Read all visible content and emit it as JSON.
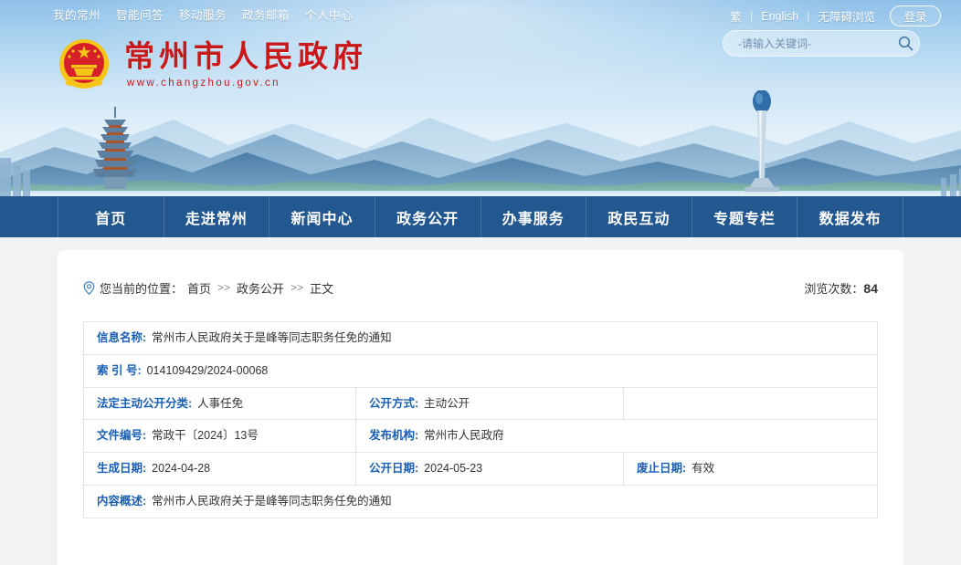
{
  "topbar": {
    "links": [
      {
        "label": "我的常州",
        "name": "topnav-my-changzhou"
      },
      {
        "label": "智能问答",
        "name": "topnav-smart-qa"
      },
      {
        "label": "移动服务",
        "name": "topnav-mobile-service"
      },
      {
        "label": "政务邮箱",
        "name": "topnav-gov-mail"
      },
      {
        "label": "个人中心",
        "name": "topnav-user-center"
      }
    ],
    "tools": {
      "traditional": "繁",
      "english": "English",
      "accessibility": "无障碍浏览",
      "separator": "|",
      "login_label": "登录"
    }
  },
  "search": {
    "placeholder": "-请输入关键词-",
    "value": "",
    "icon": "search-icon"
  },
  "logo": {
    "emblem": "national-emblem-icon",
    "title": "常州市人民政府",
    "url": "www.changzhou.gov.cn"
  },
  "mainnav": {
    "items": [
      {
        "label": "首页",
        "name": "nav-home"
      },
      {
        "label": "走进常州",
        "name": "nav-about-changzhou"
      },
      {
        "label": "新闻中心",
        "name": "nav-news-center"
      },
      {
        "label": "政务公开",
        "name": "nav-gov-disclosure"
      },
      {
        "label": "办事服务",
        "name": "nav-services"
      },
      {
        "label": "政民互动",
        "name": "nav-interaction"
      },
      {
        "label": "专题专栏",
        "name": "nav-special-topics"
      },
      {
        "label": "数据发布",
        "name": "nav-data-release"
      }
    ]
  },
  "breadcrumb": {
    "icon": "location-pin-icon",
    "prefix": "您当前的位置：",
    "items": [
      "首页",
      "政务公开",
      "正文"
    ],
    "separator": ">>"
  },
  "views": {
    "label": "浏览次数：",
    "count": "84"
  },
  "info_table": {
    "rows": [
      [
        {
          "label": "信息名称:",
          "value": "常州市人民政府关于是峰等同志职务任免的通知",
          "span": "full",
          "name": "info-cell-name"
        }
      ],
      [
        {
          "label": "索 引 号:",
          "value": "014109429/2024-00068",
          "span": "full",
          "name": "info-cell-index"
        }
      ],
      [
        {
          "label": "法定主动公开分类:",
          "value": "人事任免",
          "span": "c1",
          "name": "info-cell-category"
        },
        {
          "label": "公开方式:",
          "value": "主动公开",
          "span": "c2",
          "name": "info-cell-disclosure-mode"
        },
        {
          "label": "",
          "value": "",
          "span": "c3",
          "name": "info-cell-empty"
        }
      ],
      [
        {
          "label": "文件编号:",
          "value": "常政干〔2024〕13号",
          "span": "c1",
          "name": "info-cell-doc-number"
        },
        {
          "label": "发布机构:",
          "value": "常州市人民政府",
          "span": "c2wide",
          "name": "info-cell-publisher"
        }
      ],
      [
        {
          "label": "生成日期:",
          "value": "2024-04-28",
          "span": "c1",
          "name": "info-cell-created-date"
        },
        {
          "label": "公开日期:",
          "value": "2024-05-23",
          "span": "c2",
          "name": "info-cell-published-date"
        },
        {
          "label": "废止日期:",
          "value": "有效",
          "span": "c3",
          "name": "info-cell-expiry-date"
        }
      ],
      [
        {
          "label": "内容概述:",
          "value": "常州市人民政府关于是峰等同志职务任免的通知",
          "span": "full",
          "name": "info-cell-summary"
        }
      ]
    ]
  },
  "colors": {
    "nav_blue": "#22578f",
    "label_blue": "#1a5fb4",
    "logo_red": "#c8181a",
    "page_bg": "#f1f2f4"
  }
}
